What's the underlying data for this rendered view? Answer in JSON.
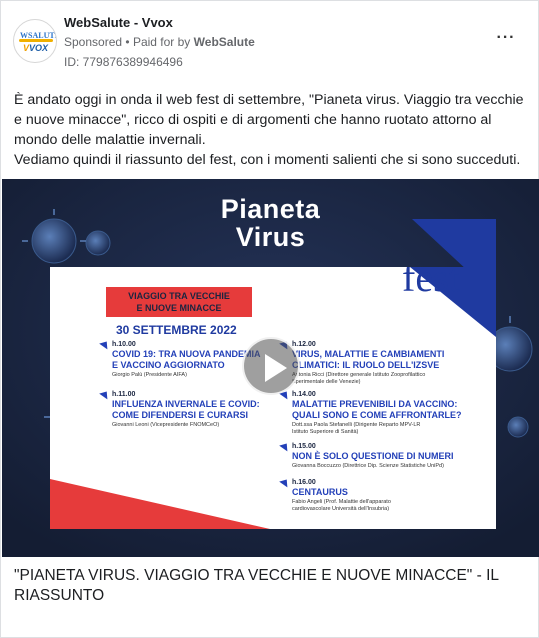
{
  "post": {
    "page_name": "WebSalute - Vvox",
    "sponsored": "Sponsored",
    "separator": "•",
    "paid_for_by_prefix": "Paid for by",
    "paid_for_by_name": "WebSalute",
    "ad_id": "ID: 779876389946496",
    "more_icon": "more-horizontal-icon",
    "avatar": {
      "logo_line1": "WSALUTE",
      "logo_line2_a": "V",
      "logo_line2_b": "VOX"
    },
    "body_paragraphs": [
      "È andato oggi in onda il web fest di settembre, \"Pianeta virus. Viaggio tra vecchie e nuove minacce\", ricco di ospiti e di argomenti che hanno ruotato attorno al mondo delle malattie invernali.",
      "Vediamo quindi il riassunto del fest, con i momenti salienti che si sono succeduti."
    ],
    "caption": "\"PIANETA VIRUS. VIAGGIO TRA VECCHIE E NUOVE MINACCE\" - IL RIASSUNTO"
  },
  "poster": {
    "title_line1": "Pianeta",
    "title_line2": "Virus",
    "fest_word": "fest",
    "subtitle_line1": "VIAGGIO TRA VECCHIE",
    "subtitle_line2": "E NUOVE MINACCE",
    "date": "30 SETTEMBRE 2022",
    "events_left": [
      {
        "hour": "h.10.00",
        "title_line1": "COVID 19: TRA NUOVA PANDEMIA",
        "title_line2": "E VACCINO AGGIORNATO",
        "speaker_line1": "Giorgio Palù (Presidente AIFA)",
        "speaker_line2": ""
      },
      {
        "hour": "h.11.00",
        "title_line1": "INFLUENZA INVERNALE E COVID:",
        "title_line2": "COME DIFENDERSI E CURARSI",
        "speaker_line1": "Giovanni Leoni (Vicepresidente FNOMCeO)",
        "speaker_line2": ""
      }
    ],
    "events_right": [
      {
        "hour": "h.12.00",
        "title_line1": "VIRUS, MALATTIE E CAMBIAMENTI",
        "title_line2": "CLIMATICI: IL RUOLO DELL'IZSVE",
        "speaker_line1": "Antonia Ricci (Direttore generale Istituto Zooprofilattico",
        "speaker_line2": "Sperimentale delle Venezie)"
      },
      {
        "hour": "h.14.00",
        "title_line1": "MALATTIE PREVENIBILI DA VACCINO:",
        "title_line2": "QUALI SONO E COME AFFRONTARLE?",
        "speaker_line1": "Dott.ssa Paola Stefanelli (Dirigente Reparto MPV-LR",
        "speaker_line2": "Istituto Superiore di Sanità)"
      },
      {
        "hour": "h.15.00",
        "title_line1": "NON È SOLO QUESTIONE DI NUMERI",
        "title_line2": "",
        "speaker_line1": "Giovanna Boccuzzo (Direttrice Dip. Scienze Statistiche UniPd)",
        "speaker_line2": ""
      },
      {
        "hour": "h.16.00",
        "title_line1": "CENTAURUS",
        "title_line2": "",
        "speaker_line1": "Fabio Angeli (Prof. Malattie dell'apparato",
        "speaker_line2": "cardiovascolare Università dell'Insubria)"
      }
    ],
    "play_icon": "play-icon"
  },
  "colors": {
    "poster_bg": "#1a2540",
    "accent_red": "#e63b3b",
    "accent_blue": "#2340b8",
    "fest_blue": "#1f3aa0",
    "text_gray": "#65676b"
  }
}
